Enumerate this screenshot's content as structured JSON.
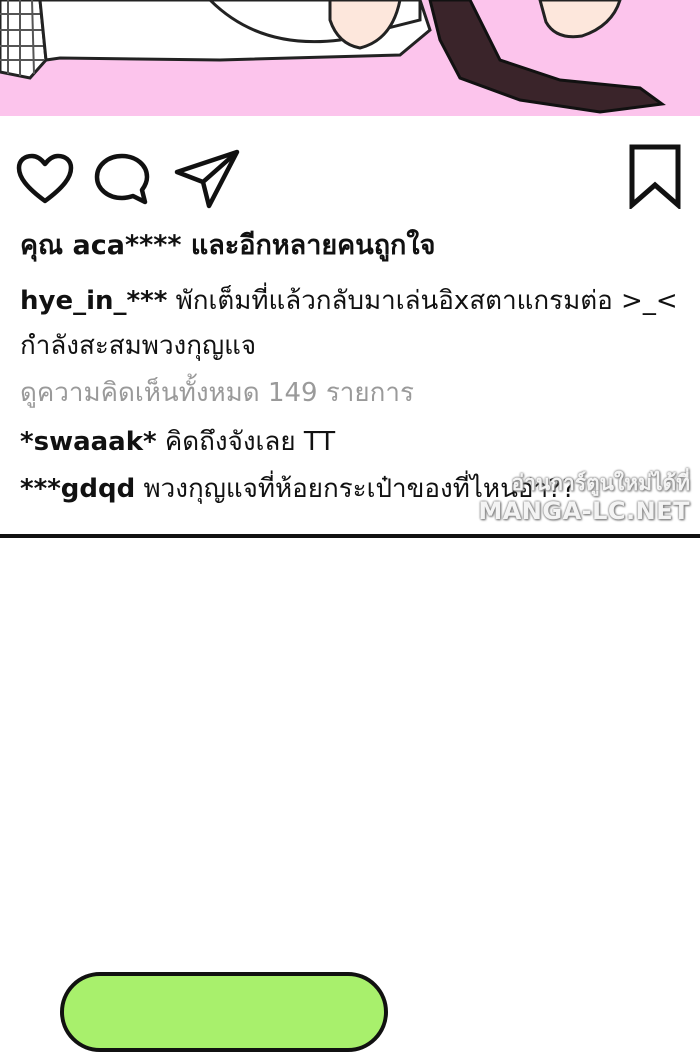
{
  "post": {
    "likes_text": "คุณ aca**** และอีกหลายคนถูกใจ",
    "caption": {
      "username": "hye_in_***",
      "line1": "พักเต็มที่แล้วกลับมาเล่นอิxสตาแกรมต่อ >_<",
      "line2": "กำลังสะสมพวงกุญแจ"
    },
    "view_comments": "ดูความคิดเห็นทั้งหมด 149 รายการ",
    "comments": [
      {
        "username": "*swaaak*",
        "text": "คิดถึงจังเลย TT"
      },
      {
        "username": "***gdqd",
        "text": "พวงกุญแจที่ห้อยกระเป๋าของที่ไหนอ่า??"
      }
    ]
  },
  "icons": {
    "like": "heart-icon",
    "comment": "comment-bubble-icon",
    "share": "send-paper-plane-icon",
    "save": "bookmark-icon"
  },
  "watermark": {
    "line1": "อ่านการ์ตูนใหม่ได้ที่",
    "line2": "MANGA-LC.NET"
  },
  "colors": {
    "panel_pink": "#fcc4ec",
    "button_green": "#a8f06c",
    "muted_text": "#9a9a9a"
  }
}
